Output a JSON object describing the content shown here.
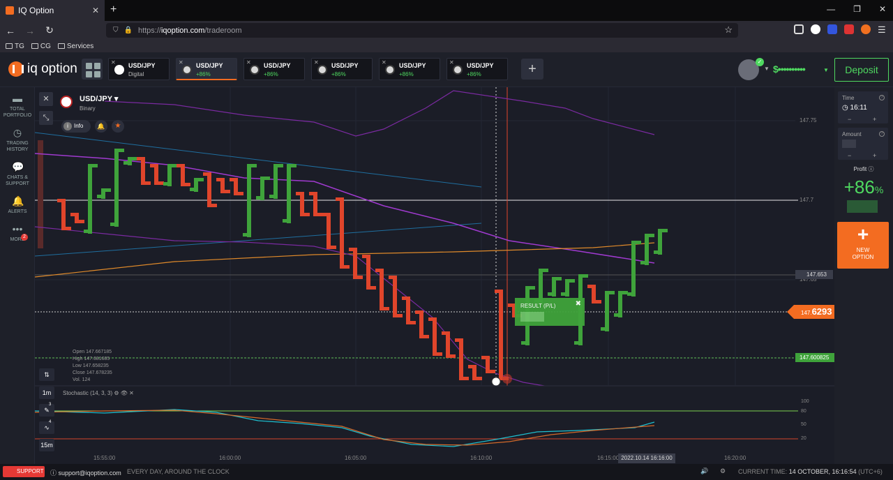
{
  "browser": {
    "tab_title": "IQ Option",
    "new_tab": "+",
    "url_prefix": "https://",
    "url_host": "iqoption.com",
    "url_path": "/traderoom",
    "bookmarks": [
      "TG",
      "CG",
      "Services"
    ]
  },
  "header": {
    "logo_text": "iq option",
    "tabs": [
      {
        "name": "USD/JPY",
        "sub": "Digital",
        "active": false
      },
      {
        "name": "USD/JPY",
        "sub": "+86%",
        "active": true
      },
      {
        "name": "USD/JPY",
        "sub": "+86%",
        "active": false
      },
      {
        "name": "USD/JPY",
        "sub": "+86%",
        "active": false
      },
      {
        "name": "USD/JPY",
        "sub": "+86%",
        "active": false
      },
      {
        "name": "USD/JPY",
        "sub": "+86%",
        "active": false
      }
    ],
    "add_tab": "+",
    "balance": "$••••••••••",
    "deposit_label": "Deposit"
  },
  "sidebar": {
    "items": [
      {
        "label": "TOTAL PORTFOLIO",
        "icon": "briefcase-icon"
      },
      {
        "label": "TRADING HISTORY",
        "icon": "history-icon"
      },
      {
        "label": "CHATS & SUPPORT",
        "icon": "chat-icon"
      },
      {
        "label": "ALERTS",
        "icon": "bell-icon"
      },
      {
        "label": "MORE",
        "icon": "more-icon"
      }
    ],
    "more_badge": "2"
  },
  "chart": {
    "asset": "USD/JPY",
    "asset_type": "Binary",
    "info_label": "Info",
    "price_labels": [
      "147.75",
      "147.7",
      "147.65"
    ],
    "alert_price": "147.653",
    "current_price_prefix": "147.",
    "current_price_main": "6293",
    "open_price": "147.600825",
    "ohlc": {
      "open": "Open  147.667185",
      "high": "High  147.681685",
      "low": "Low  147.658235",
      "close": "Close  147.678235",
      "vol": "Vol.  124"
    },
    "result_title": "RESULT (P/L)",
    "stochastic_label": "Stochastic (14, 3, 3)",
    "stoch_levels": [
      "100",
      "80",
      "50",
      "20"
    ],
    "timeframes": [
      "1m",
      "15m"
    ],
    "tool_badges": [
      "3",
      "4"
    ],
    "time_labels": [
      "15:55:00",
      "16:00:00",
      "16:05:00",
      "16:10:00",
      "16:15:00",
      "16:20:00"
    ],
    "hover_time": "2022.10.14 16:16:00"
  },
  "chart_data": {
    "type": "candlestick",
    "ylim": [
      147.595,
      147.765
    ],
    "candles_close_direction": [
      "down",
      "down",
      "up",
      "up",
      "up",
      "up",
      "down",
      "down",
      "up",
      "down",
      "up",
      "down",
      "down",
      "down",
      "up",
      "up",
      "up",
      "up",
      "down",
      "down",
      "down",
      "down",
      "down",
      "down",
      "down",
      "down",
      "down",
      "down",
      "down",
      "down",
      "down",
      "down",
      "down",
      "down",
      "down",
      "up",
      "up",
      "up",
      "up",
      "up",
      "down",
      "up",
      "up",
      "up",
      "up",
      "up"
    ]
  },
  "right_panel": {
    "time_label": "Time",
    "time_value": "16:11",
    "amount_label": "Amount",
    "profit_label": "Profit",
    "profit_value": "+86",
    "profit_unit": "%",
    "new_option_label": "NEW OPTION"
  },
  "status": {
    "support_label": "SUPPORT",
    "support_email": "support@iqoption.com",
    "support_tagline": "EVERY DAY, AROUND THE CLOCK",
    "current_time_label": "CURRENT TIME:",
    "current_time_value": "14 OCTOBER, 16:16:54",
    "timezone": "(UTC+6)"
  },
  "colors": {
    "accent": "#f36c21",
    "up": "#3fa33b",
    "down": "#e0452b",
    "brand_green": "#4fd960"
  }
}
